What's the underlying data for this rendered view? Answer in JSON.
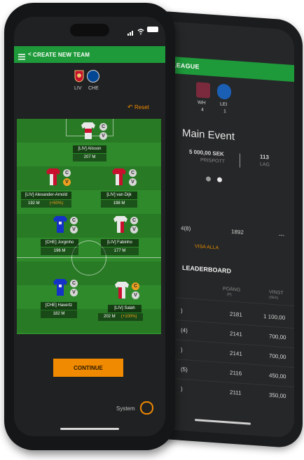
{
  "front": {
    "header": {
      "title": "CREATE NEW TEAM",
      "back_glyph": "<",
      "menu_icon": "hamburger-icon"
    },
    "match": {
      "home_team": "LIV",
      "away_team": "CHE"
    },
    "reset_label": "Reset",
    "players": [
      {
        "team": "LIV",
        "name": "Alisson",
        "price": "207 M",
        "bonus": "",
        "kit": "liverpool"
      },
      {
        "team": "LIV",
        "name": "Alexander-Arnold",
        "price": "192 M",
        "bonus": "(+50%)",
        "kit": "liverpool",
        "captain": "V"
      },
      {
        "team": "LIV",
        "name": "van Dijk",
        "price": "198 M",
        "bonus": "",
        "kit": "liverpool"
      },
      {
        "team": "CHE",
        "name": "Jorginho",
        "price": "196 M",
        "bonus": "",
        "kit": "chelsea"
      },
      {
        "team": "LIV",
        "name": "Fabinho",
        "price": "177 M",
        "bonus": "",
        "kit": "liverpool"
      },
      {
        "team": "CHE",
        "name": "Havertz",
        "price": "182 M",
        "bonus": "",
        "kit": "chelsea"
      },
      {
        "team": "LIV",
        "name": "Salah",
        "price": "202 M",
        "bonus": "(+100%)",
        "kit": "liverpool",
        "captain": "C"
      }
    ],
    "badges": {
      "c": "C",
      "v": "V"
    },
    "continue_label": "CONTINUE",
    "system_label": "System"
  },
  "back": {
    "header_title": "LEAGUE",
    "teams": [
      {
        "abbr": "WH",
        "score": "4"
      },
      {
        "abbr": "LEI",
        "score": "1"
      }
    ],
    "event_title": "Main Event",
    "prize_value": "5 000,00 SEK",
    "prize_label": "PRISPOTT",
    "teams_value": "113",
    "teams_label": "LAG",
    "row_pos": "4(8)",
    "row_points": "1892",
    "row_prize": "---",
    "show_all": "VISA ALLA",
    "leaderboard_title": "LEADERBOARD",
    "col_points": "POÄNG",
    "col_points_sub": "(P)",
    "col_prize": "VINST",
    "col_prize_sub": "(SEK)",
    "rows": [
      {
        "pos": ")",
        "points": "2181",
        "prize": "1 100,00"
      },
      {
        "pos": "(4)",
        "points": "2141",
        "prize": "700,00"
      },
      {
        "pos": ")",
        "points": "2141",
        "prize": "700,00"
      },
      {
        "pos": "(5)",
        "points": "2116",
        "prize": "450,00"
      },
      {
        "pos": ")",
        "points": "2111",
        "prize": "350,00"
      }
    ]
  },
  "colors": {
    "green": "#1e9a3a",
    "orange": "#f08a00",
    "pitch": "#2f8a2c",
    "screen": "#202122"
  }
}
